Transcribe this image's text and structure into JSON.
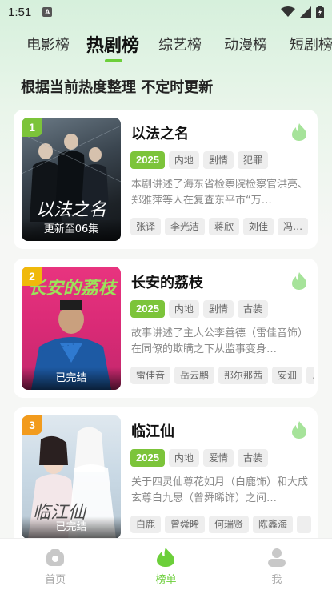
{
  "status_bar": {
    "time": "1:51",
    "notification_letter": "A"
  },
  "tabs": [
    {
      "label": "电影榜",
      "active": false
    },
    {
      "label": "热剧榜",
      "active": true
    },
    {
      "label": "综艺榜",
      "active": false
    },
    {
      "label": "动漫榜",
      "active": false
    },
    {
      "label": "短剧榜",
      "active": false
    }
  ],
  "subtitle": "根据当前热度整理 不定时更新",
  "accent_color": "#6ccf3a",
  "cards": [
    {
      "rank": "1",
      "rank_color": "#7cc43a",
      "title": "以法之名",
      "year": "2025",
      "tags": [
        "内地",
        "剧情",
        "犯罪"
      ],
      "description": "本剧讲述了海东省检察院检察官洪亮、郑雅萍等人在复查东平市“万…",
      "cast": [
        "张译",
        "李光洁",
        "蒋欣",
        "刘佳",
        "冯…"
      ],
      "poster_caption": "更新至06集",
      "poster_title_art": "以法之名"
    },
    {
      "rank": "2",
      "rank_color": "#f0b90b",
      "title": "长安的荔枝",
      "year": "2025",
      "tags": [
        "内地",
        "剧情",
        "古装"
      ],
      "description": "故事讲述了主人公李善德（雷佳音饰）在同僚的欺瞒之下从监事变身…",
      "cast": [
        "雷佳音",
        "岳云鹏",
        "那尔那茜",
        "安沺",
        "…"
      ],
      "poster_caption": "已完结",
      "poster_title_art": "长安的荔枝"
    },
    {
      "rank": "3",
      "rank_color": "#f29b1d",
      "title": "临江仙",
      "year": "2025",
      "tags": [
        "内地",
        "爱情",
        "古装"
      ],
      "description": "关于四灵仙尊花如月（白鹿饰）和大成玄尊白九思（曾舜晞饰）之间…",
      "cast": [
        "白鹿",
        "曾舜晞",
        "何瑞贤",
        "陈鑫海",
        ""
      ],
      "poster_caption": "已完结",
      "poster_title_art": "临江仙"
    }
  ],
  "bottom_nav": [
    {
      "label": "首页",
      "icon": "home-icon",
      "active": false
    },
    {
      "label": "榜单",
      "icon": "flame-icon",
      "active": true
    },
    {
      "label": "我",
      "icon": "person-icon",
      "active": false
    }
  ]
}
